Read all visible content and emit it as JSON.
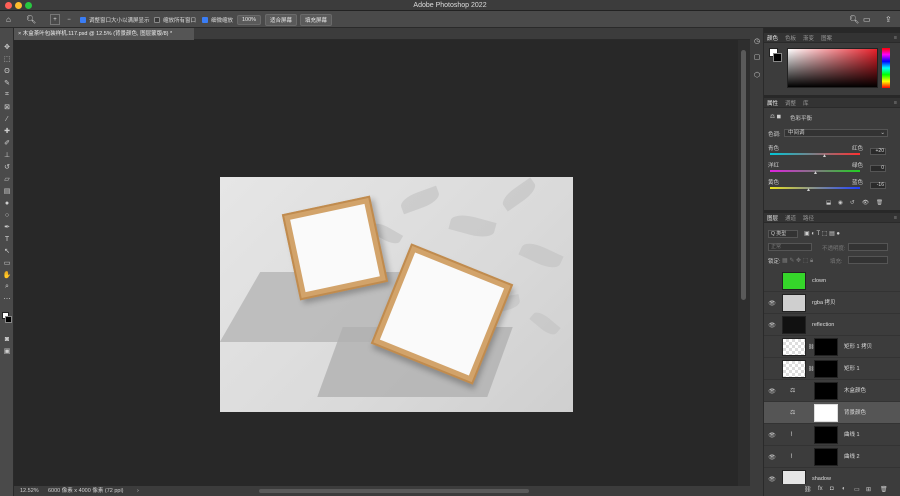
{
  "app": {
    "title": "Adobe Photoshop 2022",
    "colors": {
      "close": "#fe5f57",
      "minimize": "#febc2e",
      "maximize": "#28c840",
      "accent": "#3a7df5"
    }
  },
  "options_bar": {
    "home_icon": "home-icon",
    "zoom_tool_icon": "zoom-icon",
    "resize_windows_label": "调整窗口大小以满屏显示",
    "zoom_all_label": "缩放所有窗口",
    "scrubby_zoom_label": "细微缩放",
    "zoom_100_label": "100%",
    "fit_screen_label": "适合屏幕",
    "fill_screen_label": "填充屏幕"
  },
  "document_tab": {
    "title": "木盒茶叶包装样机.117.psd @ 12.5% (背景颜色, 图层蒙版/8) *"
  },
  "status_bar": {
    "zoom": "12.52%",
    "doc_info": "6000 像素 x 4000 像素 (72 ppi)"
  },
  "color_panel": {
    "tabs": [
      "颜色",
      "色板",
      "渐变",
      "图案"
    ],
    "active": "颜色"
  },
  "properties_panel": {
    "tabs": [
      "属性",
      "调整",
      "库"
    ],
    "active": "属性",
    "adjustment_title": "色彩平衡",
    "tone_label": "色调:",
    "tone_value": "中间调",
    "sliders": [
      {
        "left": "青色",
        "right": "红色",
        "value": "+20",
        "position": 0.6
      },
      {
        "left": "洋红",
        "right": "绿色",
        "value": "0",
        "position": 0.5
      },
      {
        "left": "黄色",
        "right": "蓝色",
        "value": "-16",
        "position": 0.42
      }
    ]
  },
  "layers_panel": {
    "tabs": [
      "图层",
      "通道",
      "路径"
    ],
    "active": "图层",
    "filter_label": "Q 类型",
    "blend_mode": "正常",
    "opacity_label": "不透明度:",
    "lock_label": "锁定:",
    "fill_label": "填充:",
    "layers": [
      {
        "name": "clown",
        "visible": false,
        "selected": false,
        "thumb": "#35d62a"
      },
      {
        "name": "rgba 拷贝",
        "visible": true,
        "selected": false,
        "thumb": "#cfcfcf"
      },
      {
        "name": "reflection",
        "visible": true,
        "selected": false,
        "thumb": "#111111"
      },
      {
        "name": "矩形 1 拷贝",
        "visible": false,
        "selected": false,
        "thumb": "#ffffff"
      },
      {
        "name": "矩形 1",
        "visible": false,
        "selected": false,
        "thumb": "#ffffff"
      },
      {
        "name": "木盒颜色",
        "visible": true,
        "selected": false,
        "thumb": "#000000"
      },
      {
        "name": "背景颜色",
        "visible": false,
        "selected": true,
        "thumb": "#ffffff"
      },
      {
        "name": "曲线 1",
        "visible": true,
        "selected": false,
        "thumb": "#000000"
      },
      {
        "name": "曲线 2",
        "visible": true,
        "selected": false,
        "thumb": "#000000"
      },
      {
        "name": "shadow",
        "visible": true,
        "selected": false,
        "thumb": "#e5e5e5"
      }
    ]
  }
}
